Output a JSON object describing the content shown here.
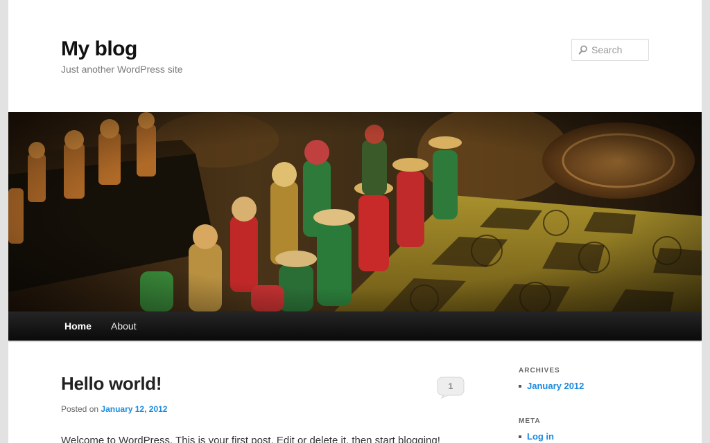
{
  "site": {
    "title": "My blog",
    "description": "Just another WordPress site"
  },
  "search": {
    "placeholder": "Search",
    "value": ""
  },
  "header_image": {
    "description_icon": "chess-pieces-photo"
  },
  "nav": {
    "items": [
      {
        "label": "Home"
      },
      {
        "label": "About"
      }
    ]
  },
  "post": {
    "title": "Hello world!",
    "comment_count": "1",
    "meta_prefix": "Posted on",
    "date": "January 12, 2012",
    "content": "Welcome to WordPress. This is your first post. Edit or delete it, then start blogging!"
  },
  "sidebar": {
    "archives": {
      "title": "ARCHIVES",
      "items": [
        {
          "label": "January 2012"
        }
      ]
    },
    "meta": {
      "title": "META",
      "items": [
        {
          "label": "Log in"
        }
      ]
    }
  },
  "colors": {
    "link": "#1b8be0",
    "nav_bg": "#111111",
    "page_bg": "#ffffff",
    "outer_bg": "#e2e2e2"
  }
}
